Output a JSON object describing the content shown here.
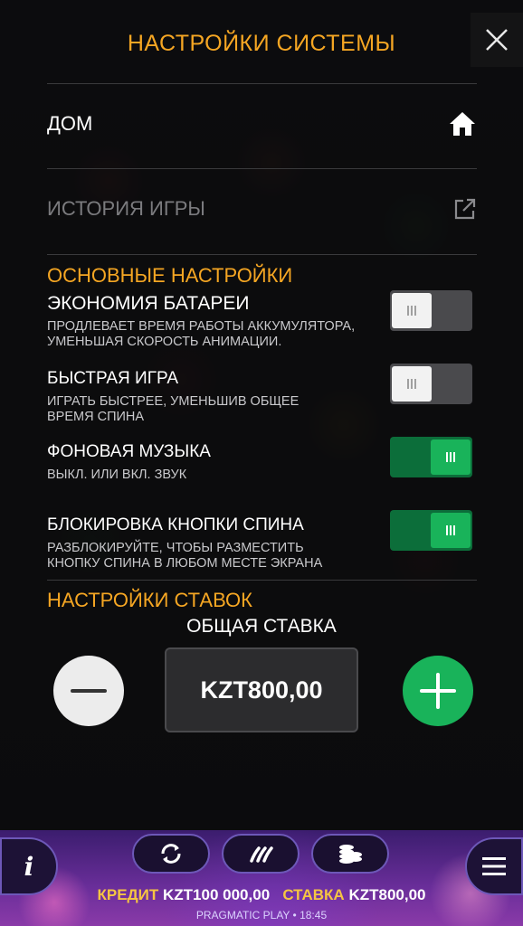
{
  "header": {
    "title": "НАСТРОЙКИ СИСТЕМЫ"
  },
  "menu": {
    "home_label": "ДОМ",
    "history_label": "ИСТОРИЯ ИГРЫ"
  },
  "sections": {
    "main_title": "ОСНОВНЫЕ НАСТРОЙКИ",
    "bet_title": "НАСТРОЙКИ СТАВОК"
  },
  "settings": [
    {
      "name": "ЭКОНОМИЯ БАТАРЕИ",
      "desc1": "ПРОДЛЕВАЕТ ВРЕМЯ РАБОТЫ АККУМУЛЯТОРА,",
      "desc2": "УМЕНЬШАЯ СКОРОСТЬ АНИМАЦИИ.",
      "on": false
    },
    {
      "name": "БЫСТРАЯ ИГРА",
      "desc1": "ИГРАТЬ БЫСТРЕЕ, УМЕНЬШИВ ОБЩЕЕ",
      "desc2": "ВРЕМЯ СПИНА",
      "on": false
    },
    {
      "name": "ФОНОВАЯ МУЗЫКА",
      "desc1": "ВЫКЛ. ИЛИ ВКЛ. ЗВУК",
      "desc2": "",
      "on": true
    },
    {
      "name": "БЛОКИРОВКА КНОПКИ СПИНА",
      "desc1": "РАЗБЛОКИРУЙТЕ, ЧТОБЫ РАЗМЕСТИТЬ",
      "desc2": "КНОПКУ СПИНА В ЛЮБОМ МЕСТЕ ЭКРАНА",
      "on": true
    }
  ],
  "bet": {
    "label": "ОБЩАЯ СТАВКА",
    "value": "KZT800,00"
  },
  "footer": {
    "credit_label": "КРЕДИТ",
    "credit_value": "KZT100 000,00",
    "bet_label": "СТАВКА",
    "bet_value": "KZT800,00",
    "brand": "PRAGMATIC PLAY • 18:45"
  },
  "colors": {
    "accent": "#f5a623",
    "toggle_on": "#19b35a",
    "toggle_off": "#4a4a4d"
  },
  "icons": {
    "close": "close-icon",
    "home": "home-icon",
    "external": "external-link-icon",
    "info": "info-icon",
    "autoplay": "autoplay-icon",
    "turbo": "turbo-icon",
    "coins": "coins-icon",
    "menu": "hamburger-menu-icon"
  }
}
